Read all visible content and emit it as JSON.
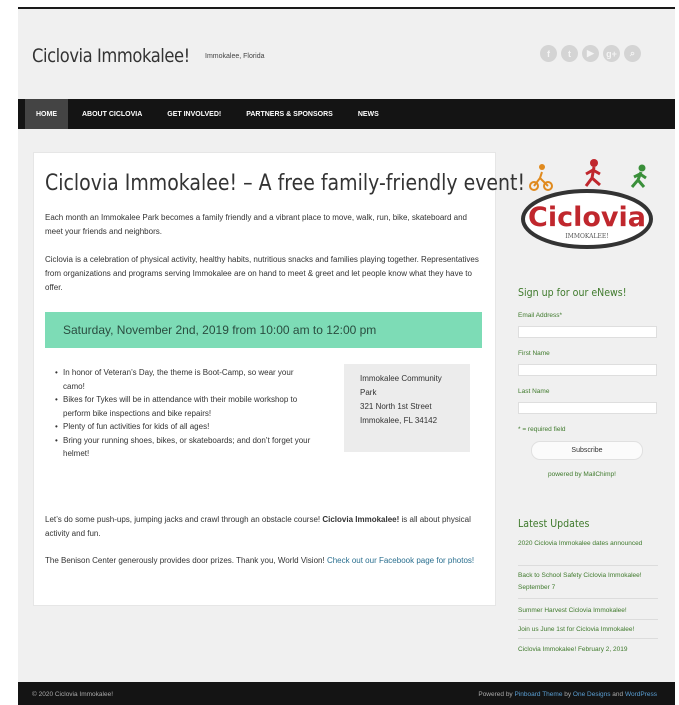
{
  "header": {
    "site_title": "Ciclovia Immokalee!",
    "tagline": "Immokalee, Florida",
    "social_icons": [
      "facebook-icon",
      "twitter-icon",
      "youtube-icon",
      "google-plus-icon",
      "search-icon"
    ]
  },
  "nav": {
    "items": [
      "HOME",
      "ABOUT CICLOVIA",
      "GET INVOLVED!",
      "PARTNERS & SPONSORS",
      "NEWS"
    ],
    "active": "HOME"
  },
  "main": {
    "title": "Ciclovia Immokalee! – A free family-friendly event!",
    "intro_1": "Each month an Immokalee Park becomes a family friendly and a vibrant place to move, walk, run, bike, skateboard and meet your friends and neighbors.",
    "intro_2": "Ciclovia is a celebration of physical activity, healthy habits, nutritious snacks and families playing together. Representatives from organizations and programs serving Immokalee are on hand to meet & greet and let people know what they have to offer.",
    "banner": "Saturday, November 2nd, 2019 from 10:00 am to 12:00 pm",
    "bullets": [
      "In honor of Veteran’s Day, the theme is Boot-Camp, so wear your camo!",
      "Bikes for Tykes will be in attendance with their mobile workshop to perform bike inspections and bike repairs!",
      "Plenty of fun activities for kids of all ages!",
      "Bring your running shoes, bikes, or skateboards; and don’t forget your helmet!"
    ],
    "address": {
      "line1": "Immokalee Community",
      "line2": "Park",
      "line3": "321 North 1st Street",
      "line4": "Immokalee, FL 34142"
    },
    "para_1_pre": "Let’s do some push-ups, jumping jacks and crawl through an obstacle course!  ",
    "para_1_bold": "Ciclovia Immokalee!",
    "para_1_post": " is all about physical activity and fun.",
    "para_2_pre": "The Benison Center generously provides door prizes. Thank you, World Vision! ",
    "para_2_link": "Check out our Facebook page for photos!"
  },
  "sidebar": {
    "logo_text": "Ciclovia",
    "logo_subtext": "IMMOKALEE!",
    "signup_heading": "Sign up for our eNews!",
    "email_label": "Email Address*",
    "first_name_label": "First Name",
    "last_name_label": "Last Name",
    "required_note": "* = required field",
    "subscribe_label": "Subscribe",
    "powered_by": "powered by MailChimp!",
    "updates_heading": "Latest Updates",
    "updates": [
      "2020 Ciclovia Immokalee dates announced",
      "Back to School Safety Ciclovia Immokalee! September 7",
      "Summer Harvest Ciclovia Immokalee!",
      "Join us June 1st for Ciclovia Immokalee!",
      "Ciclovia Immokalee! February 2, 2019"
    ]
  },
  "footer": {
    "copyright": "© 2020 Ciclovia Immokalee!",
    "powered_pre": "Powered by ",
    "theme_link": "Pinboard Theme",
    "by": " by ",
    "designer_link": "One Designs",
    "and": " and ",
    "wp_link": "WordPress"
  },
  "colors": {
    "nav_bg": "#141414",
    "banner_bg": "#7ddcb6",
    "sidebar_accent": "#3f7a2c",
    "link": "#2a6f8f"
  }
}
